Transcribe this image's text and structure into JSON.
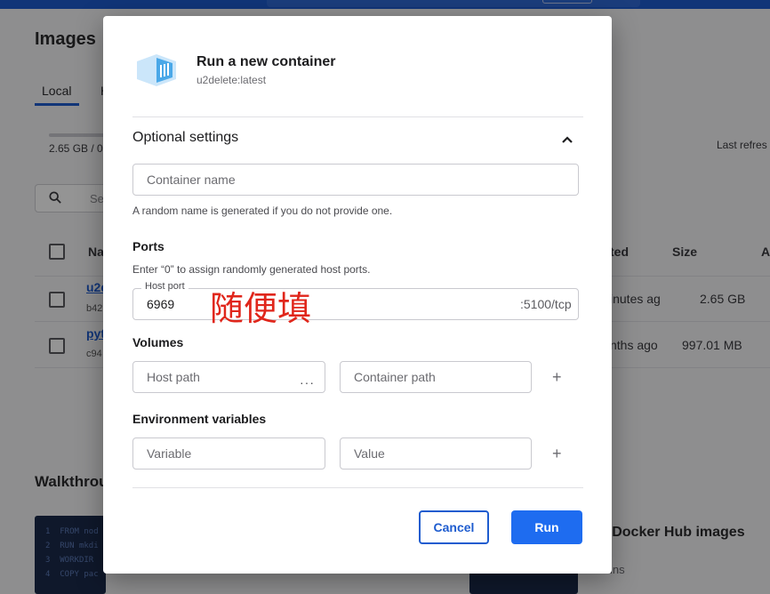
{
  "background": {
    "page_title": "Images",
    "tabs": [
      "Local",
      "H"
    ],
    "storage_text": "2.65 GB / 0",
    "refresh_text": "Last refres",
    "search_placeholder": "Se",
    "columns": {
      "name": "Na",
      "created": "ted",
      "size": "Size",
      "actions": "A"
    },
    "rows": [
      {
        "name": "u2d",
        "id": "b42",
        "created": "inutes ag",
        "size": "2.65 GB"
      },
      {
        "name": "pyt",
        "id": "c94",
        "created": "nths ago",
        "size": "997.01 MB"
      }
    ],
    "walkthrough_title": "Walkthrou",
    "code_lines": [
      {
        "num": "1",
        "text": "FROM nod"
      },
      {
        "num": "2",
        "text": "RUN mkdi"
      },
      {
        "num": "3",
        "text": "WORKDIR"
      },
      {
        "num": "4",
        "text": "COPY pac"
      }
    ],
    "card_title": "n Docker Hub images",
    "card_subtitle": "ins"
  },
  "modal": {
    "title": "Run a new container",
    "subtitle": "u2delete:latest",
    "icon": "docker-image-icon",
    "section_title": "Optional settings",
    "container_name": {
      "placeholder": "Container name",
      "value": "",
      "help": "A random name is generated if you do not provide one."
    },
    "ports": {
      "label": "Ports",
      "help": "Enter “0” to assign randomly generated host ports.",
      "host_port_label": "Host port",
      "host_port_value": "6969",
      "container_port": ":5100/tcp",
      "annotation": "随便填"
    },
    "volumes": {
      "label": "Volumes",
      "host_placeholder": "Host path",
      "container_placeholder": "Container path",
      "browse": "···",
      "add": "+"
    },
    "env": {
      "label": "Environment variables",
      "variable_placeholder": "Variable",
      "value_placeholder": "Value",
      "add": "+"
    },
    "buttons": {
      "cancel": "Cancel",
      "run": "Run"
    },
    "colors": {
      "accent": "#1e6cf0",
      "annotation": "#e0261b",
      "icon": "#4aa8e8"
    }
  }
}
